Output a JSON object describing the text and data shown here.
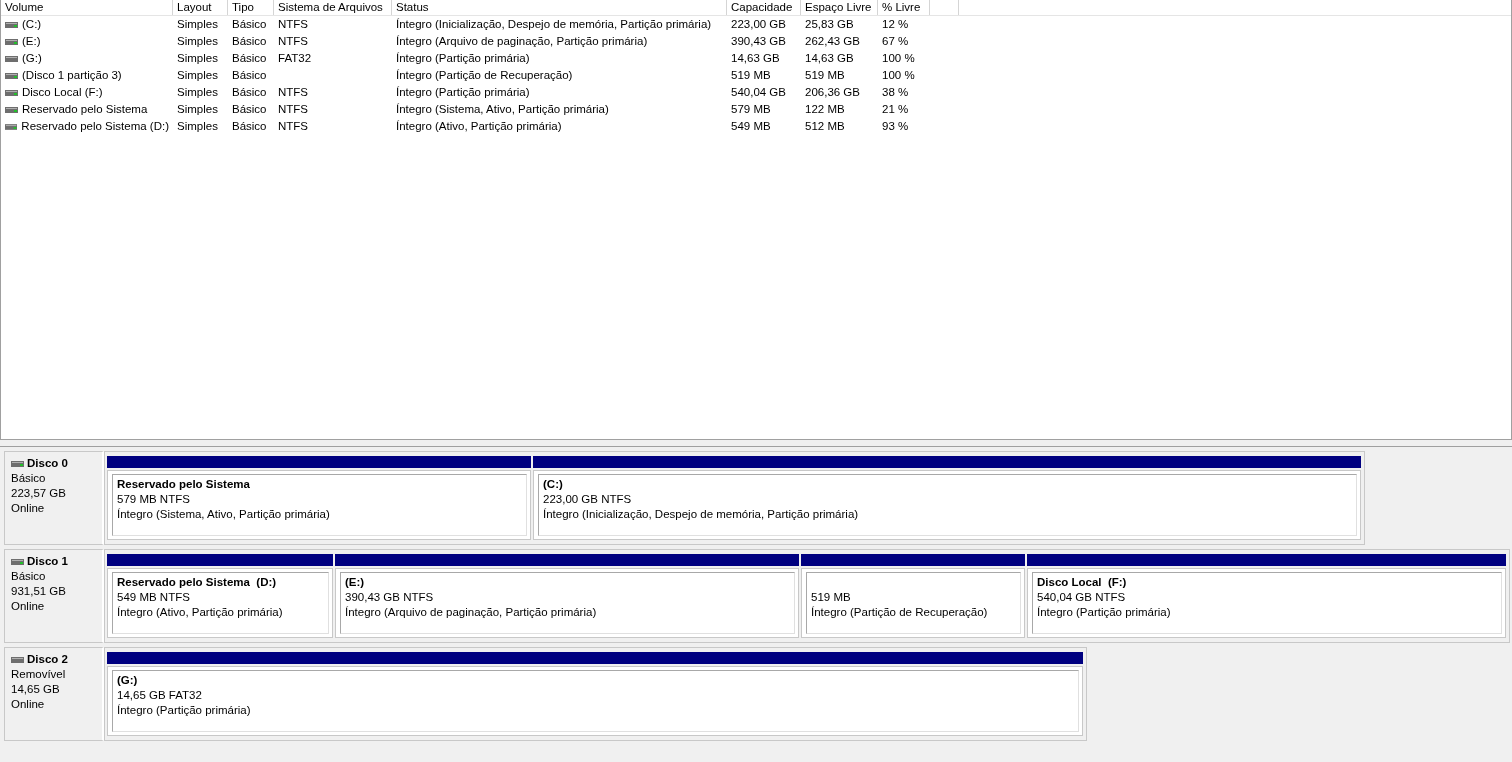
{
  "volume_list": {
    "columns": [
      "Volume",
      "Layout",
      "Tipo",
      "Sistema de Arquivos",
      "Status",
      "Capacidade",
      "Espaço Livre",
      "% Livre"
    ],
    "rows": [
      {
        "kind": "fixed",
        "cells": [
          "(C:)",
          "Simples",
          "Básico",
          "NTFS",
          "Íntegro (Inicialização, Despejo de memória, Partição primária)",
          "223,00 GB",
          "25,83 GB",
          "12 %"
        ]
      },
      {
        "kind": "fixed",
        "cells": [
          "(E:)",
          "Simples",
          "Básico",
          "NTFS",
          "Íntegro (Arquivo de paginação, Partição primária)",
          "390,43 GB",
          "262,43 GB",
          "67 %"
        ]
      },
      {
        "kind": "removable",
        "cells": [
          "(G:)",
          "Simples",
          "Básico",
          "FAT32",
          "Íntegro (Partição primária)",
          "14,63 GB",
          "14,63 GB",
          "100 %"
        ]
      },
      {
        "kind": "fixed",
        "cells": [
          "(Disco 1 partição 3)",
          "Simples",
          "Básico",
          "",
          "Íntegro (Partição de Recuperação)",
          "519 MB",
          "519 MB",
          "100 %"
        ]
      },
      {
        "kind": "fixed",
        "cells": [
          "Disco Local (F:)",
          "Simples",
          "Básico",
          "NTFS",
          "Íntegro (Partição primária)",
          "540,04 GB",
          "206,36 GB",
          "38 %"
        ]
      },
      {
        "kind": "fixed",
        "cells": [
          "Reservado pelo Sistema",
          "Simples",
          "Básico",
          "NTFS",
          "Íntegro (Sistema, Ativo, Partição primária)",
          "579 MB",
          "122 MB",
          "21 %"
        ]
      },
      {
        "kind": "fixed",
        "cells": [
          "Reservado pelo Sistema (D:)",
          "Simples",
          "Básico",
          "NTFS",
          "Íntegro (Ativo, Partição primária)",
          "549 MB",
          "512 MB",
          "93 %"
        ]
      }
    ]
  },
  "disks": [
    {
      "name": "Disco 0",
      "kind": "fixed",
      "type": "Básico",
      "size": "223,57 GB",
      "state": "Online",
      "partitions": [
        {
          "title": "Reservado pelo Sistema",
          "size_fs": "579 MB NTFS",
          "status": "Íntegro (Sistema, Ativo, Partição primária)"
        },
        {
          "title": "(C:)",
          "size_fs": "223,00 GB NTFS",
          "status": "Íntegro (Inicialização, Despejo de memória, Partição primária)"
        }
      ]
    },
    {
      "name": "Disco 1",
      "kind": "fixed",
      "type": "Básico",
      "size": "931,51 GB",
      "state": "Online",
      "partitions": [
        {
          "title": "Reservado pelo Sistema  (D:)",
          "size_fs": "549 MB NTFS",
          "status": "Íntegro (Ativo, Partição primária)"
        },
        {
          "title": "(E:)",
          "size_fs": "390,43 GB NTFS",
          "status": "Íntegro (Arquivo de paginação, Partição primária)"
        },
        {
          "size_fs": "519 MB",
          "status": "Íntegro (Partição de Recuperação)"
        },
        {
          "title": "Disco Local  (F:)",
          "size_fs": "540,04 GB NTFS",
          "status": "Íntegro (Partição primária)"
        }
      ]
    },
    {
      "name": "Disco 2",
      "kind": "removable",
      "type": "Removível",
      "size": "14,65 GB",
      "state": "Online",
      "partitions": [
        {
          "title": "(G:)",
          "size_fs": "14,65 GB FAT32",
          "status": "Íntegro (Partição primária)"
        }
      ]
    }
  ]
}
